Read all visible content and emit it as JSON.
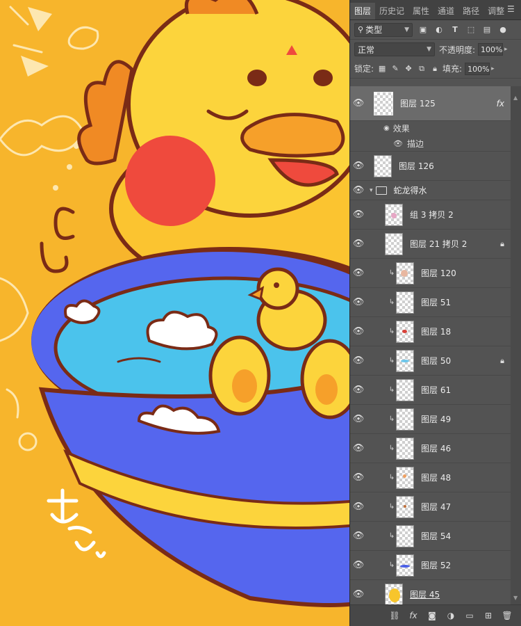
{
  "tabs": [
    "图层",
    "历史记",
    "属性",
    "通道",
    "路径",
    "调整"
  ],
  "filter": {
    "label": "类型"
  },
  "blend": {
    "mode": "正常",
    "opacity_label": "不透明度:",
    "opacity_value": "100%"
  },
  "lock": {
    "label": "锁定:",
    "fill_label": "填充:",
    "fill_value": "100%"
  },
  "layers": [
    {
      "name": "图层 125",
      "selected": true,
      "fx": "fx",
      "effects_label": "效果",
      "effect_item": "描边"
    },
    {
      "name": "图层 126"
    },
    {
      "name": "蛇龙得水",
      "group": true
    },
    {
      "name": "组 3 拷贝 2"
    },
    {
      "name": "图层 21 拷贝 2",
      "locked": true
    },
    {
      "name": "图层 120",
      "clipped": true
    },
    {
      "name": "图层 51",
      "clipped": true
    },
    {
      "name": "图层 18",
      "clipped": true
    },
    {
      "name": "图层 50",
      "clipped": true,
      "locked": true
    },
    {
      "name": "图层 61",
      "clipped": true
    },
    {
      "name": "图层 49",
      "clipped": true
    },
    {
      "name": "图层 46",
      "clipped": true
    },
    {
      "name": "图层 48",
      "clipped": true
    },
    {
      "name": "图层 47",
      "clipped": true
    },
    {
      "name": "图层 54",
      "clipped": true
    },
    {
      "name": "图层 52",
      "clipped": true
    },
    {
      "name": "图层 45"
    }
  ],
  "canvas": {
    "signature": "右意"
  }
}
